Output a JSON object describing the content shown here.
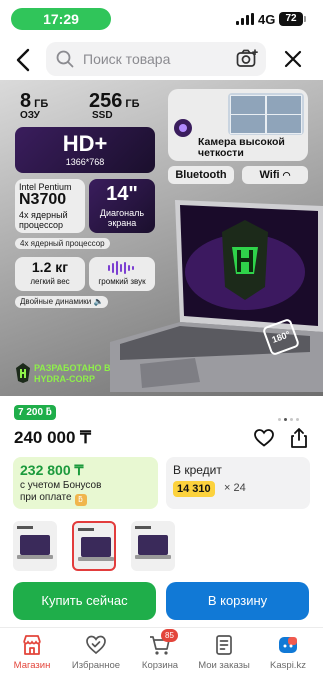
{
  "status": {
    "time": "17:29",
    "network": "4G",
    "battery": "72"
  },
  "search": {
    "placeholder": "Поиск товара"
  },
  "hero": {
    "ram_value": "8",
    "ram_unit": "ГБ",
    "ram_label": "ОЗУ",
    "ssd_value": "256",
    "ssd_unit": "ГБ",
    "ssd_label": "SSD",
    "display_title": "HD+",
    "display_resolution": "1366*768",
    "cpu_brand": "Intel Pentium",
    "cpu_model": "N3700",
    "cpu_desc": "4х ядерный процессор",
    "diagonal_value": "14\"",
    "diagonal_label": "Диагональ экрана",
    "cores_chip": "4х ядерный процессор",
    "weight_value": "1.2 кг",
    "weight_label": "легкий вес",
    "sound_label": "громкий звук",
    "speakers_label": "Двойные динамики",
    "camera_label": "Камера высокой четкости",
    "bluetooth": "Bluetooth",
    "wifi": "Wifi",
    "badge_360": "180°",
    "brand_line1": "РАЗРАБОТАНО В",
    "brand_line2": "HYDRA-CORP"
  },
  "product": {
    "bonus_badge": "7 200 ƃ",
    "price": "240 000 ₸",
    "bonus_price": "232 800 ₸",
    "bonus_note_1": "с учетом Бонусов",
    "bonus_note_2": "при оплате",
    "credit_title": "В кредит",
    "credit_amount": "14 310",
    "credit_months": "× 24"
  },
  "buttons": {
    "buy_now": "Купить сейчас",
    "add_to_cart": "В корзину"
  },
  "tabbar": {
    "items": [
      {
        "label": "Магазин"
      },
      {
        "label": "Избранное"
      },
      {
        "label": "Корзина"
      },
      {
        "label": "Мои заказы"
      },
      {
        "label": "Kaspi.kz"
      }
    ],
    "cart_count": "85"
  },
  "colors": {
    "accent_green": "#1fae4a",
    "accent_blue": "#1179d6",
    "accent_red": "#e3453b",
    "credit_yellow": "#fcd23d"
  }
}
